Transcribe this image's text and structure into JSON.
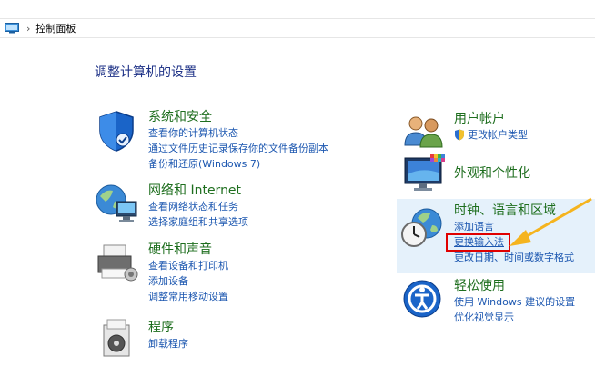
{
  "address_bar": {
    "crumb": "控制面板"
  },
  "page_title": "调整计算机的设置",
  "left_categories": [
    {
      "title": "系统和安全",
      "links": [
        "查看你的计算机状态",
        "通过文件历史记录保存你的文件备份副本",
        "备份和还原(Windows 7)"
      ]
    },
    {
      "title": "网络和 Internet",
      "links": [
        "查看网络状态和任务",
        "选择家庭组和共享选项"
      ]
    },
    {
      "title": "硬件和声音",
      "links": [
        "查看设备和打印机",
        "添加设备",
        "调整常用移动设置"
      ]
    },
    {
      "title": "程序",
      "links": [
        "卸载程序"
      ]
    }
  ],
  "right_categories": [
    {
      "title": "用户帐户",
      "links": [
        "更改帐户类型"
      ]
    },
    {
      "title": "外观和个性化",
      "links": []
    },
    {
      "title": "时钟、语言和区域",
      "links": [
        "添加语言",
        "更换输入法",
        "更改日期、时间或数字格式"
      ]
    },
    {
      "title": "轻松使用",
      "links": [
        "使用 Windows 建议的设置",
        "优化视觉显示"
      ]
    }
  ],
  "colors": {
    "title_green": "#1e6e1e",
    "link_blue": "#1c57b0",
    "highlight": "#e5f1fb",
    "annotation_red": "#e00000",
    "arrow_orange": "#f5b41e"
  }
}
